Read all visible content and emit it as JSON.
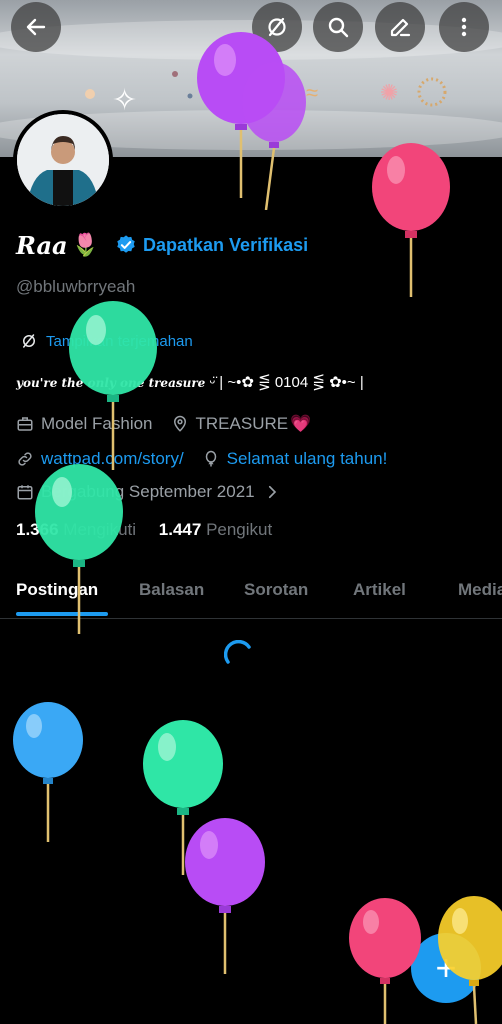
{
  "profile": {
    "name": "Raa",
    "verify_label": "Dapatkan Verifikasi",
    "handle": "@bbluwbrryeah",
    "translate_label": "Tampilkan terjemahan",
    "bio_script": "you're the only one treasure",
    "bio_rest": " ᵕ̈ | ~•✿ ⋚ 0104 ⋚ ✿•~ |",
    "profession": "Model Fashion",
    "location": "TREASURE",
    "link": "wattpad.com/story/",
    "birthday": "Selamat ulang tahun!",
    "joined": "Bergabung September 2021",
    "following_count": "1.366",
    "following_label": "Mengikuti",
    "followers_count": "1.447",
    "followers_label": "Pengikut"
  },
  "tabs": [
    {
      "label": "Postingan"
    },
    {
      "label": "Balasan"
    },
    {
      "label": "Sorotan"
    },
    {
      "label": "Artikel"
    },
    {
      "label": "Media"
    }
  ],
  "top_buttons": [
    "back-arrow-icon",
    "grok-icon",
    "search-icon",
    "edit-icon",
    "more-vertical-icon"
  ],
  "colors": {
    "accent": "#1d9bf0",
    "background": "#000000",
    "balloon_purple": "#b84cf5",
    "balloon_pink": "#f2457a",
    "balloon_mint": "#2fe6a6",
    "balloon_blue": "#3aa8f5",
    "balloon_yellow": "#fbd02a"
  },
  "fab_symbol": "+"
}
